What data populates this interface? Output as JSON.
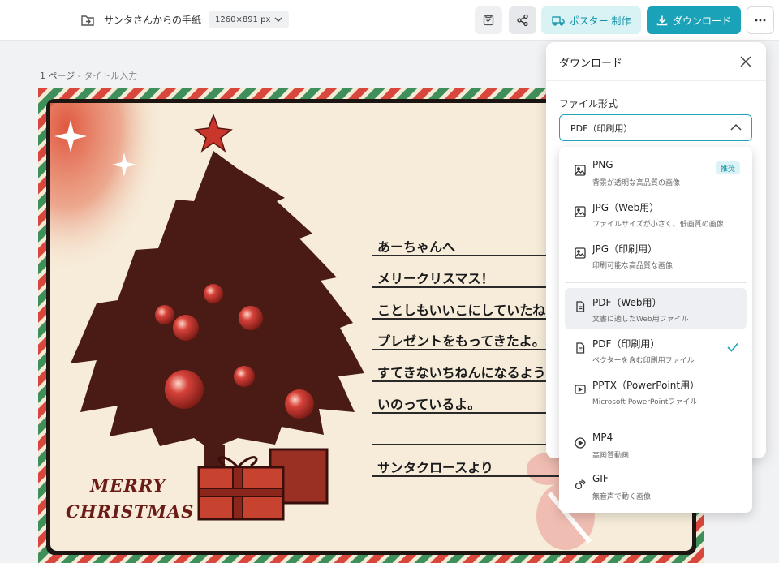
{
  "header": {
    "doc_title": "サンタさんからの手紙",
    "size_chip": "1260×891 px",
    "poster_label": "ポスター 制作",
    "download_label": "ダウンロード"
  },
  "page": {
    "label": "1 ページ",
    "label_suffix": " - タイトル入力"
  },
  "card": {
    "lines": [
      "あーちゃんへ",
      "メリークリスマス！",
      "ことしもいいこにしていたね",
      "プレゼントをもってきたよ。",
      "すてきないちねんになるよう",
      "いのっているよ。",
      "",
      "サンタクロースより"
    ],
    "merry": "MERRY",
    "christmas": "CHRISTMAS"
  },
  "panel": {
    "title": "ダウンロード",
    "format_label": "ファイル形式",
    "selected": "PDF（印刷用）"
  },
  "options": [
    {
      "title": "PNG",
      "desc": "背景が透明な高品質の画像",
      "badge": "推奨",
      "icon": "image-icon"
    },
    {
      "title": "JPG（Web用）",
      "desc": "ファイルサイズが小さく、低画質の画像",
      "icon": "image-icon"
    },
    {
      "title": "JPG（印刷用）",
      "desc": "印刷可能な高品質な画像",
      "icon": "image-icon"
    },
    {
      "title": "PDF（Web用）",
      "desc": "文書に適したWeb用ファイル",
      "icon": "document-icon"
    },
    {
      "title": "PDF（印刷用）",
      "desc": "ベクターを含む印刷用ファイル",
      "icon": "document-icon"
    },
    {
      "title": "PPTX（PowerPoint用）",
      "desc": "Microsoft PowerPointファイル",
      "icon": "slides-icon"
    },
    {
      "title": "MP4",
      "desc": "高画質動画",
      "icon": "play-icon"
    },
    {
      "title": "GIF",
      "desc": "無音声で動く画像",
      "icon": "gif-icon"
    }
  ],
  "colors": {
    "accent": "#1aa3b8",
    "stripe_red": "#d9473c",
    "stripe_green": "#3f8f5a",
    "card_bg": "#f6ecd9",
    "tree": "#4a1a14"
  }
}
